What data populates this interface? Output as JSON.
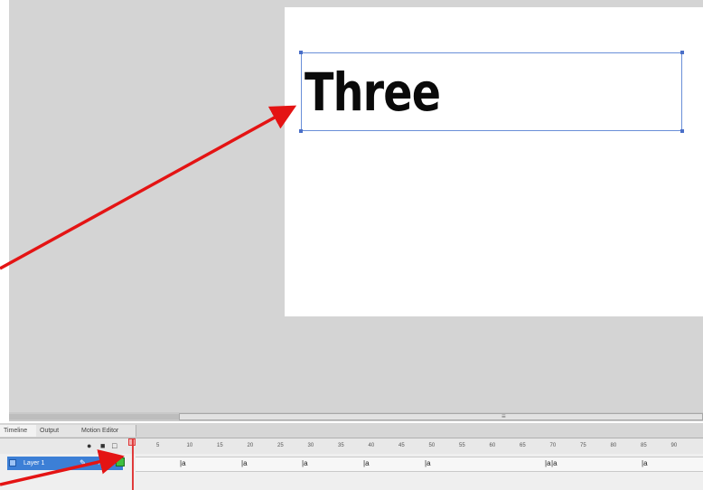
{
  "stage": {
    "text": "Three"
  },
  "timeline": {
    "tabs": [
      "Timeline",
      "Output",
      "Motion Editor"
    ],
    "header_icons": [
      "eye-icon",
      "lock-icon",
      "outline-icon"
    ],
    "frame_numbers": [
      "5",
      "10",
      "15",
      "20",
      "25",
      "30",
      "35",
      "40",
      "45",
      "50",
      "55",
      "60",
      "65",
      "70",
      "75",
      "80",
      "85",
      "90"
    ],
    "layer": {
      "name": "Layer 1"
    },
    "keyframes": [
      "|a",
      "|a",
      "|a",
      "|a",
      "|a",
      "|a",
      "|a",
      "|a"
    ]
  },
  "annotations": {
    "arrow_color": "#e41414"
  },
  "colors": {
    "pasteboard": "#d4d4d4",
    "stage": "#ffffff",
    "selection": "#6a8fd8",
    "layer_selected": "#3c7fd6",
    "keyframe": "#3fbf3f",
    "playhead": "#e03b3b"
  }
}
